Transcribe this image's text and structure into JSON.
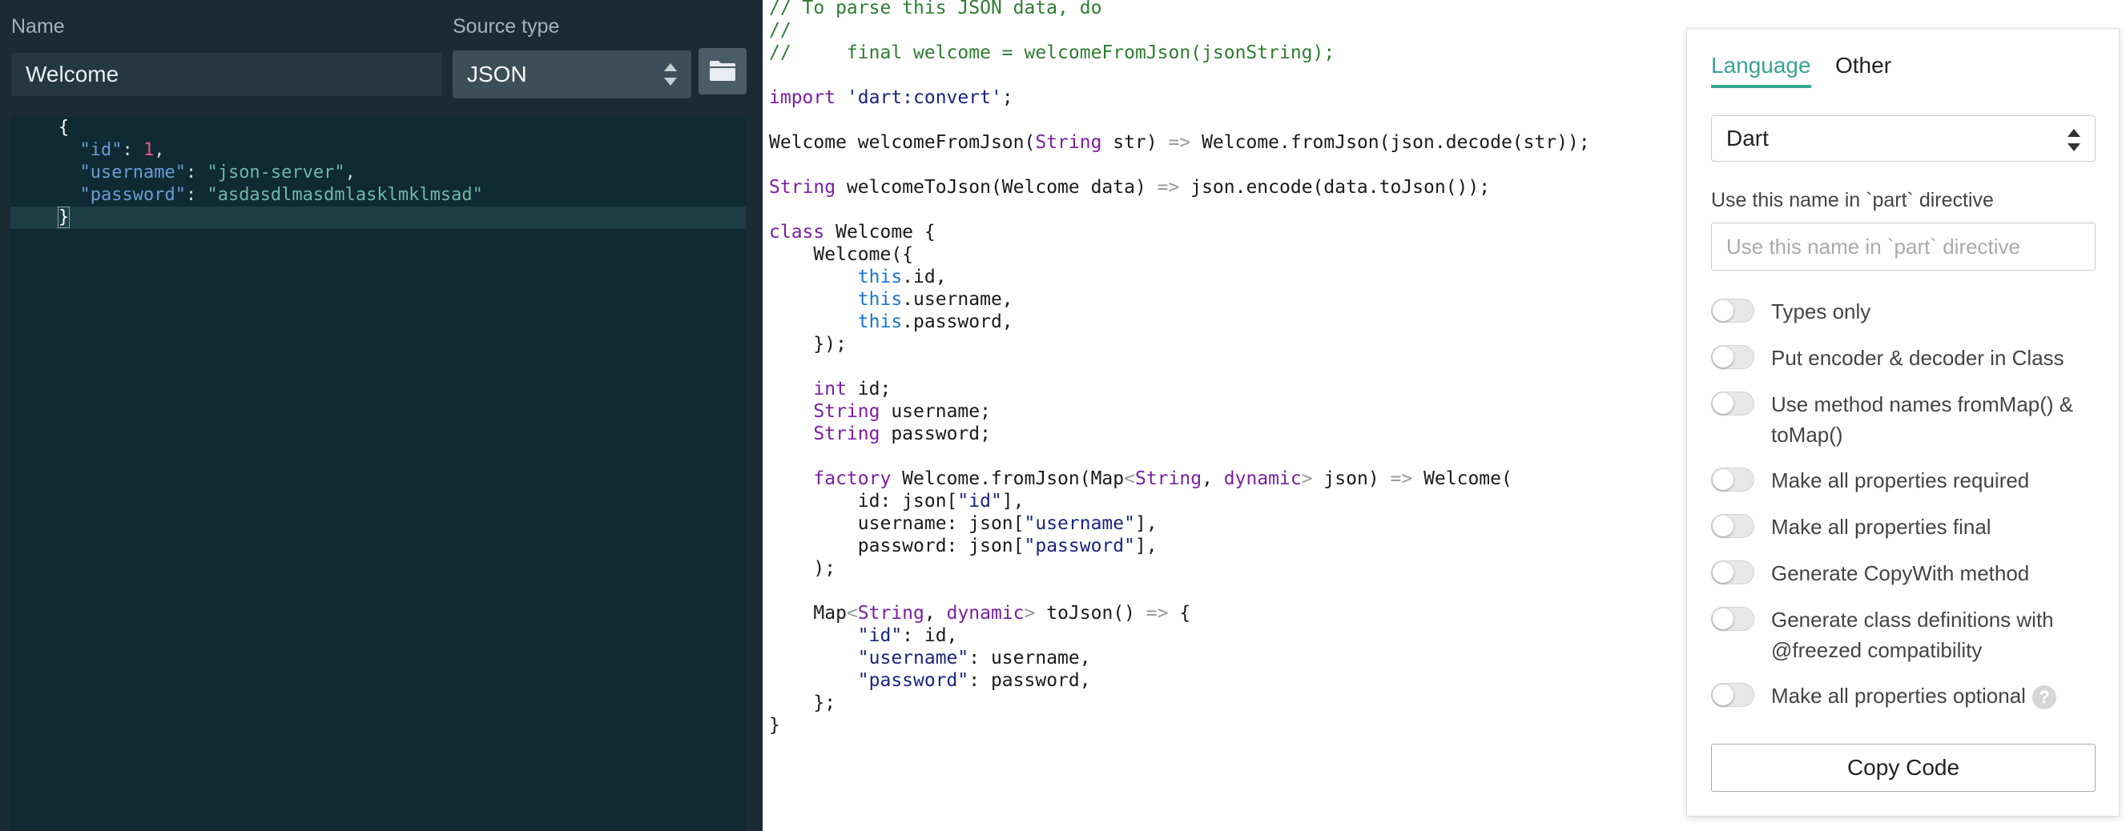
{
  "left": {
    "name_label": "Name",
    "name_value": "Welcome",
    "source_type_label": "Source type",
    "source_type_value": "JSON",
    "open_file_icon": "folder-icon",
    "json_lines": [
      [
        {
          "t": "{",
          "c": "brace"
        }
      ],
      [
        {
          "t": "  \"id\"",
          "c": "ek"
        },
        {
          "t": ": ",
          "c": "ep"
        },
        {
          "t": "1",
          "c": "en"
        },
        {
          "t": ",",
          "c": "ep"
        }
      ],
      [
        {
          "t": "  \"username\"",
          "c": "ek"
        },
        {
          "t": ": ",
          "c": "ep"
        },
        {
          "t": "\"json-server\"",
          "c": "es"
        },
        {
          "t": ",",
          "c": "ep"
        }
      ],
      [
        {
          "t": "  \"password\"",
          "c": "ek"
        },
        {
          "t": ": ",
          "c": "ep"
        },
        {
          "t": "\"asdasdlmasdmlasklmklmsad\"",
          "c": "es"
        }
      ],
      [
        {
          "t": "}",
          "c": "brace cursor-brace"
        }
      ]
    ]
  },
  "code_lines": [
    [
      {
        "t": "// To parse this JSON data, do",
        "c": "cm"
      }
    ],
    [
      {
        "t": "//",
        "c": "cm"
      }
    ],
    [
      {
        "t": "//     final welcome = welcomeFromJson(jsonString);",
        "c": "cm"
      }
    ],
    [],
    [
      {
        "t": "import ",
        "c": "kw"
      },
      {
        "t": "'dart:convert'",
        "c": "st"
      },
      {
        "t": ";",
        "c": ""
      }
    ],
    [],
    [
      {
        "t": "Welcome welcomeFromJson(",
        "c": ""
      },
      {
        "t": "String",
        "c": "kw"
      },
      {
        "t": " str) ",
        "c": ""
      },
      {
        "t": "=>",
        "c": "op"
      },
      {
        "t": " Welcome.fromJson(json.decode(str));",
        "c": ""
      }
    ],
    [],
    [
      {
        "t": "String",
        "c": "kw"
      },
      {
        "t": " welcomeToJson(Welcome data) ",
        "c": ""
      },
      {
        "t": "=>",
        "c": "op"
      },
      {
        "t": " json.encode(data.toJson());",
        "c": ""
      }
    ],
    [],
    [
      {
        "t": "class",
        "c": "kw"
      },
      {
        "t": " Welcome {",
        "c": ""
      }
    ],
    [
      {
        "t": "    Welcome({",
        "c": ""
      }
    ],
    [
      {
        "t": "        ",
        "c": ""
      },
      {
        "t": "this",
        "c": "th"
      },
      {
        "t": ".id,",
        "c": ""
      }
    ],
    [
      {
        "t": "        ",
        "c": ""
      },
      {
        "t": "this",
        "c": "th"
      },
      {
        "t": ".username,",
        "c": ""
      }
    ],
    [
      {
        "t": "        ",
        "c": ""
      },
      {
        "t": "this",
        "c": "th"
      },
      {
        "t": ".password,",
        "c": ""
      }
    ],
    [
      {
        "t": "    });",
        "c": ""
      }
    ],
    [],
    [
      {
        "t": "    ",
        "c": ""
      },
      {
        "t": "int",
        "c": "kw"
      },
      {
        "t": " id;",
        "c": ""
      }
    ],
    [
      {
        "t": "    ",
        "c": ""
      },
      {
        "t": "String",
        "c": "kw"
      },
      {
        "t": " username;",
        "c": ""
      }
    ],
    [
      {
        "t": "    ",
        "c": ""
      },
      {
        "t": "String",
        "c": "kw"
      },
      {
        "t": " password;",
        "c": ""
      }
    ],
    [],
    [
      {
        "t": "    ",
        "c": ""
      },
      {
        "t": "factory",
        "c": "kw"
      },
      {
        "t": " Welcome.fromJson(Map",
        "c": ""
      },
      {
        "t": "<",
        "c": "op"
      },
      {
        "t": "String",
        "c": "kw"
      },
      {
        "t": ", ",
        "c": ""
      },
      {
        "t": "dynamic",
        "c": "kw"
      },
      {
        "t": ">",
        "c": "op"
      },
      {
        "t": " json) ",
        "c": ""
      },
      {
        "t": "=>",
        "c": "op"
      },
      {
        "t": " Welcome(",
        "c": ""
      }
    ],
    [
      {
        "t": "        id: json[",
        "c": ""
      },
      {
        "t": "\"id\"",
        "c": "st"
      },
      {
        "t": "],",
        "c": ""
      }
    ],
    [
      {
        "t": "        username: json[",
        "c": ""
      },
      {
        "t": "\"username\"",
        "c": "st"
      },
      {
        "t": "],",
        "c": ""
      }
    ],
    [
      {
        "t": "        password: json[",
        "c": ""
      },
      {
        "t": "\"password\"",
        "c": "st"
      },
      {
        "t": "],",
        "c": ""
      }
    ],
    [
      {
        "t": "    );",
        "c": ""
      }
    ],
    [],
    [
      {
        "t": "    Map",
        "c": ""
      },
      {
        "t": "<",
        "c": "op"
      },
      {
        "t": "String",
        "c": "kw"
      },
      {
        "t": ", ",
        "c": ""
      },
      {
        "t": "dynamic",
        "c": "kw"
      },
      {
        "t": ">",
        "c": "op"
      },
      {
        "t": " toJson() ",
        "c": ""
      },
      {
        "t": "=>",
        "c": "op"
      },
      {
        "t": " {",
        "c": ""
      }
    ],
    [
      {
        "t": "        ",
        "c": ""
      },
      {
        "t": "\"id\"",
        "c": "st"
      },
      {
        "t": ": id,",
        "c": ""
      }
    ],
    [
      {
        "t": "        ",
        "c": ""
      },
      {
        "t": "\"username\"",
        "c": "st"
      },
      {
        "t": ": username,",
        "c": ""
      }
    ],
    [
      {
        "t": "        ",
        "c": ""
      },
      {
        "t": "\"password\"",
        "c": "st"
      },
      {
        "t": ": password,",
        "c": ""
      }
    ],
    [
      {
        "t": "    };",
        "c": ""
      }
    ],
    [
      {
        "t": "}",
        "c": ""
      }
    ]
  ],
  "options": {
    "tabs": [
      "Language",
      "Other"
    ],
    "language_value": "Dart",
    "part_label": "Use this name in `part` directive",
    "part_placeholder": "Use this name in `part` directive",
    "toggles": [
      {
        "label": "Types only",
        "on": false
      },
      {
        "label": "Put encoder & decoder in Class",
        "on": false
      },
      {
        "label": "Use method names fromMap() & toMap()",
        "on": false
      },
      {
        "label": "Make all properties required",
        "on": false
      },
      {
        "label": "Make all properties final",
        "on": false
      },
      {
        "label": "Generate CopyWith method",
        "on": false
      },
      {
        "label": "Generate class definitions with @freezed compatibility",
        "on": false
      },
      {
        "label": "Make all properties optional",
        "on": false
      }
    ],
    "help_glyph": "?",
    "copy_button": "Copy Code"
  },
  "colors": {
    "accent": "#3aa391",
    "left_bg": "#1b2b34",
    "editor_bg": "#0f2a33"
  }
}
